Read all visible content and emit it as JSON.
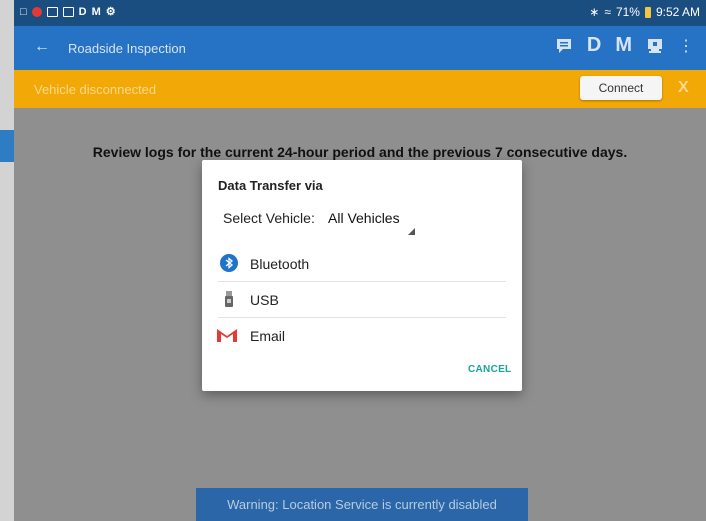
{
  "status_bar": {
    "left_icons": [
      "D",
      "M"
    ],
    "battery": "71%",
    "time": "9:52 AM"
  },
  "toolbar": {
    "back_icon": "arrow-left-icon",
    "title": "Roadside Inspection",
    "icon_d": "D",
    "icon_m": "M"
  },
  "vehicle_bar": {
    "message": "Vehicle disconnected",
    "connect_label": "Connect",
    "close_label": "X"
  },
  "main": {
    "review_text": "Review logs for the current 24-hour period and the previous 7 consecutive days.",
    "warning": "Warning: Location Service is currently disabled"
  },
  "dialog": {
    "title": "Data Transfer via",
    "select_label": "Select Vehicle:",
    "select_value": "All Vehicles",
    "options": [
      {
        "label": "Bluetooth",
        "icon": "bluetooth-icon"
      },
      {
        "label": "USB",
        "icon": "usb-icon"
      },
      {
        "label": "Email",
        "icon": "gmail-icon"
      }
    ],
    "cancel_label": "CANCEL"
  },
  "colors": {
    "status_bar": "#1a4d80",
    "toolbar": "#2672c4",
    "vehicle_bar": "#f2a806",
    "overlay": "#8f8f8f",
    "accent": "#1aa39a"
  }
}
